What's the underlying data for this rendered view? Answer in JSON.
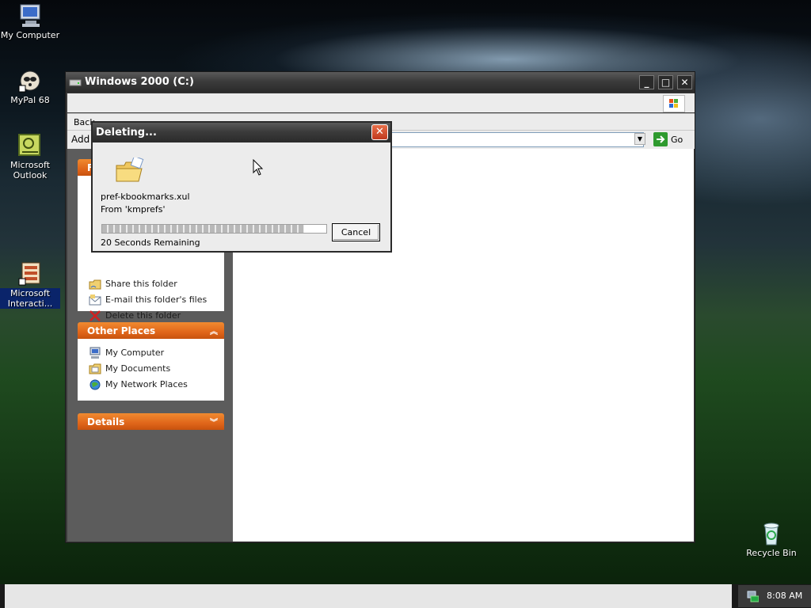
{
  "desktop": {
    "icons": [
      {
        "label": "My Computer",
        "icon": "my-computer-icon"
      },
      {
        "label": "MyPal 68",
        "icon": "mypal-icon"
      },
      {
        "label": "Microsoft Outlook",
        "icon": "outlook-icon"
      },
      {
        "label": "Microsoft Interacti...",
        "icon": "interactive-icon"
      },
      {
        "label": "Recycle Bin",
        "icon": "recycle-bin-icon"
      }
    ]
  },
  "window": {
    "title": "Windows 2000 (C:)",
    "toolbar": {
      "back_label": "Back"
    },
    "address": {
      "label": "Add",
      "go_label": "Go"
    }
  },
  "tasks_panel": {
    "header": "F",
    "items": [
      {
        "label": "Share this folder",
        "icon": "share-folder-icon"
      },
      {
        "label": "E-mail this folder's files",
        "icon": "email-icon"
      },
      {
        "label": "Delete this folder",
        "icon": "delete-x-icon"
      }
    ]
  },
  "other_places": {
    "header": "Other Places",
    "items": [
      {
        "label": "My Computer",
        "icon": "my-computer-icon"
      },
      {
        "label": "My Documents",
        "icon": "my-documents-icon"
      },
      {
        "label": "My Network Places",
        "icon": "network-places-icon"
      }
    ]
  },
  "details": {
    "header": "Details"
  },
  "dialog": {
    "title": "Deleting...",
    "file": "pref-kbookmarks.xul",
    "from": "From 'kmprefs'",
    "progress_fraction": 0.9,
    "remaining": "20 Seconds Remaining",
    "cancel_label": "Cancel"
  },
  "taskbar": {
    "clock": "8:08 AM"
  },
  "colors": {
    "accent": "#e0661a",
    "title_bar": "#3b3b3b"
  }
}
